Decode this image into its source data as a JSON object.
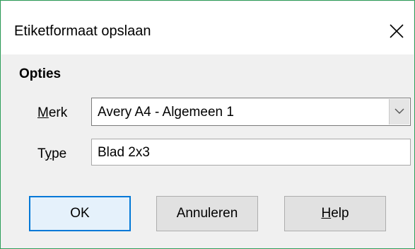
{
  "dialog": {
    "title": "Etiketformaat opslaan",
    "close_icon": "close-icon"
  },
  "options": {
    "section_label": "Opties",
    "brand": {
      "label_underlined": "M",
      "label_rest": "erk",
      "value": "Avery A4 - Algemeen 1",
      "dropdown_icon": "chevron-down-icon"
    },
    "type": {
      "label_start": "T",
      "label_underlined": "y",
      "label_rest": "pe",
      "value": "Blad 2x3"
    }
  },
  "buttons": {
    "ok_label": "OK",
    "cancel_label": "Annuleren",
    "help_underlined": "H",
    "help_rest": "elp"
  },
  "colors": {
    "window_border": "#2e9e5a",
    "default_button_border": "#0078d7"
  }
}
